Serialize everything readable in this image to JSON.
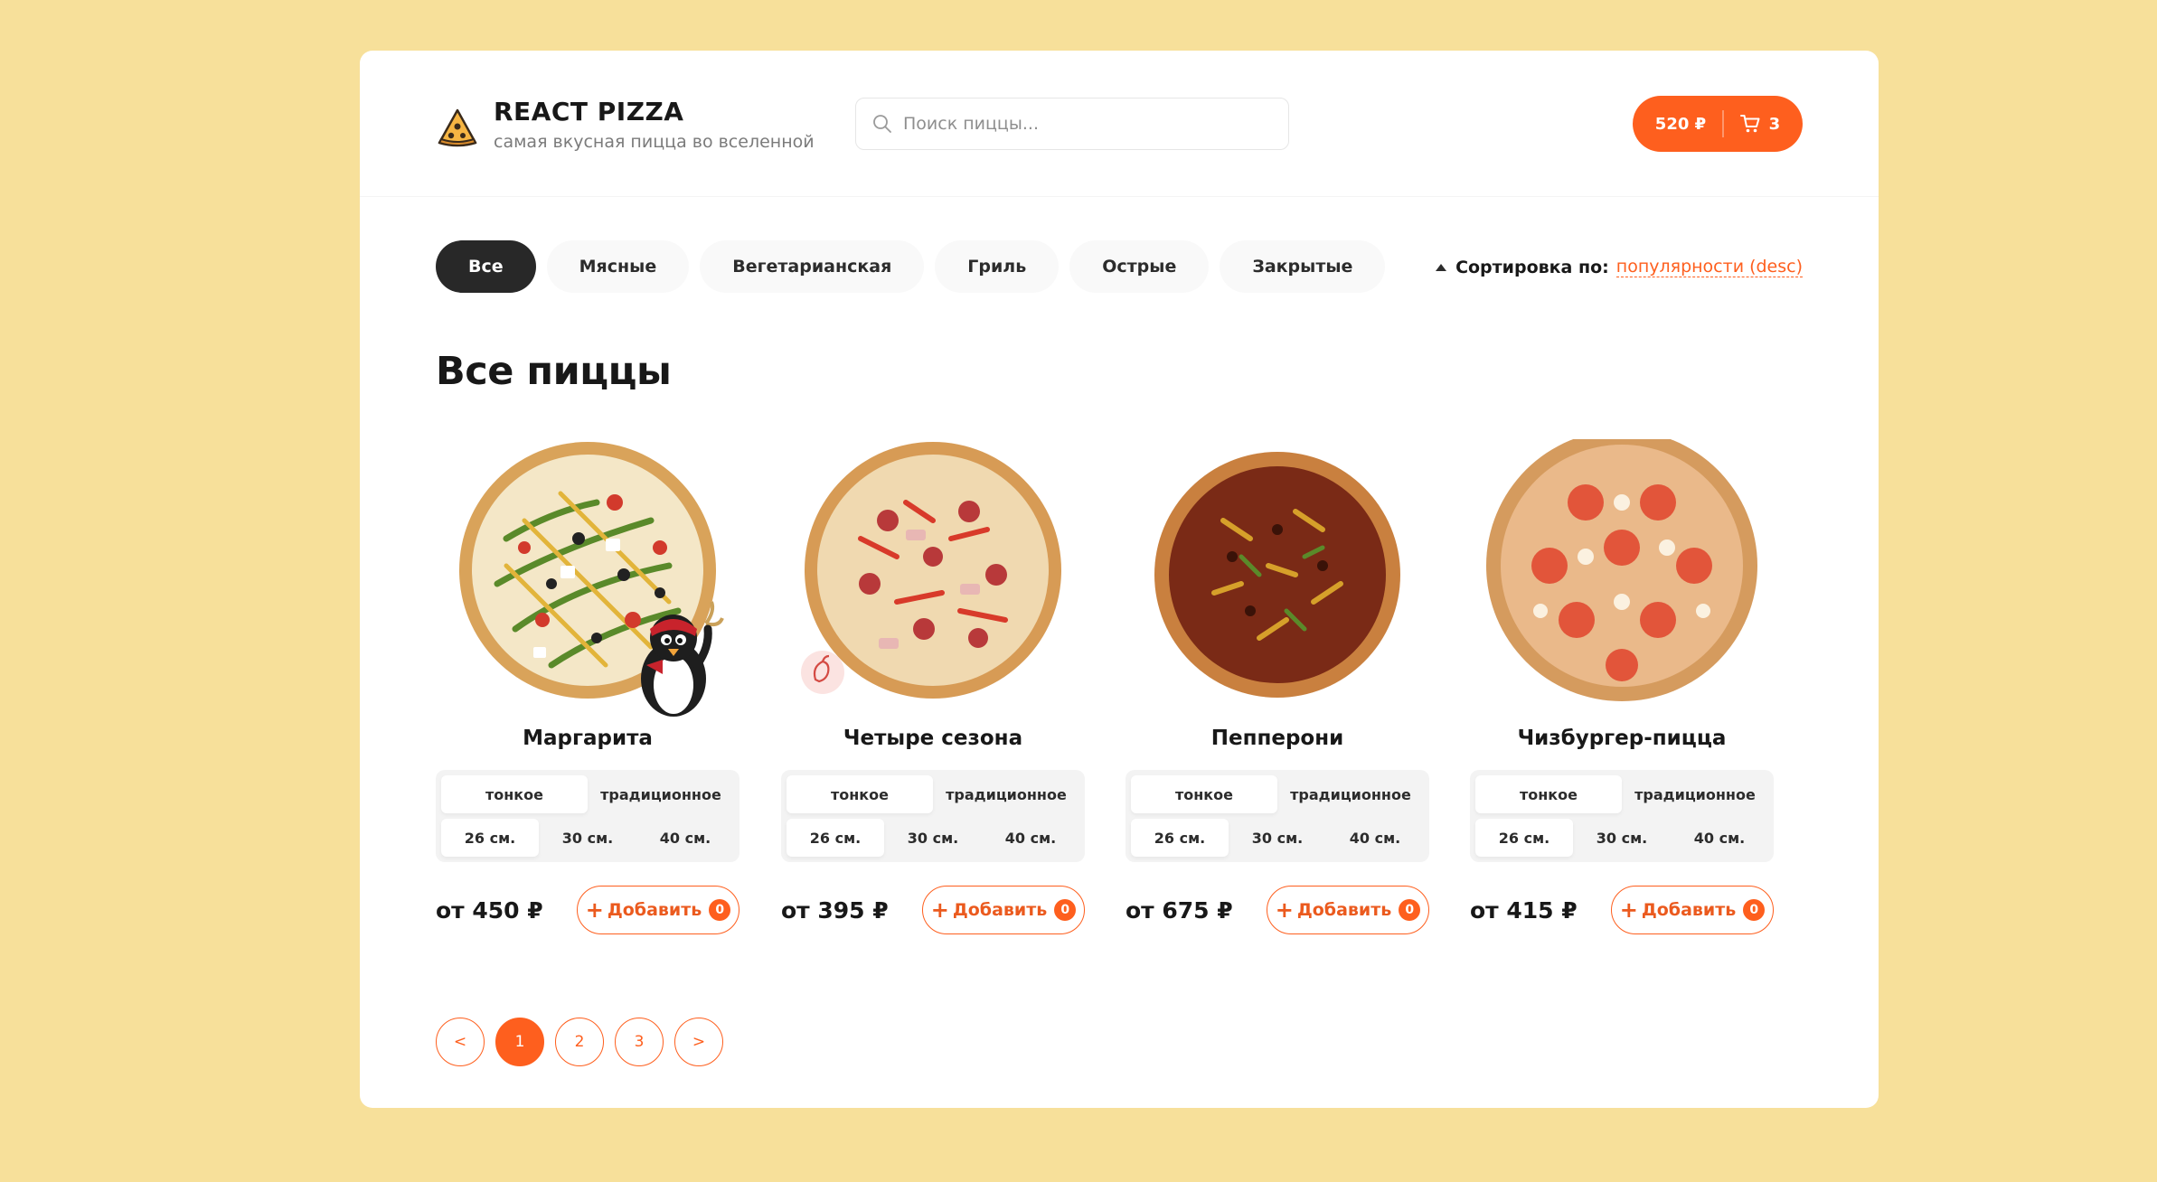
{
  "header": {
    "title": "REACT PIZZA",
    "subtitle": "самая вкусная пицца во вселенной",
    "search_placeholder": "Поиск пиццы...",
    "cart_total": "520 ₽",
    "cart_count": "3"
  },
  "categories": [
    "Все",
    "Мясные",
    "Вегетарианская",
    "Гриль",
    "Острые",
    "Закрытые"
  ],
  "active_category": "Все",
  "sort": {
    "label": "Сортировка по:",
    "value": "популярности (desc)"
  },
  "heading": "Все пиццы",
  "pizzas": [
    {
      "name": "Маргарита",
      "types": [
        "тонкое",
        "традиционное"
      ],
      "sizes": [
        "26 см.",
        "30 см.",
        "40 см."
      ],
      "price": "от 450 ₽",
      "add_label": "Добавить",
      "count": "0"
    },
    {
      "name": "Четыре сезона",
      "types": [
        "тонкое",
        "традиционное"
      ],
      "sizes": [
        "26 см.",
        "30 см.",
        "40 см."
      ],
      "price": "от 395 ₽",
      "add_label": "Добавить",
      "count": "0"
    },
    {
      "name": "Пепперони",
      "types": [
        "тонкое",
        "традиционное"
      ],
      "sizes": [
        "26 см.",
        "30 см.",
        "40 см."
      ],
      "price": "от 675 ₽",
      "add_label": "Добавить",
      "count": "0"
    },
    {
      "name": "Чизбургер-пицца",
      "types": [
        "тонкое",
        "традиционное"
      ],
      "sizes": [
        "26 см.",
        "30 см.",
        "40 см."
      ],
      "price": "от 415 ₽",
      "add_label": "Добавить",
      "count": "0"
    }
  ],
  "pagination": {
    "prev": "<",
    "pages": [
      "1",
      "2",
      "3"
    ],
    "next": ">",
    "current": "1"
  },
  "colors": {
    "accent": "#fe5f1e",
    "background": "#f7e09a",
    "dark": "#282828"
  }
}
